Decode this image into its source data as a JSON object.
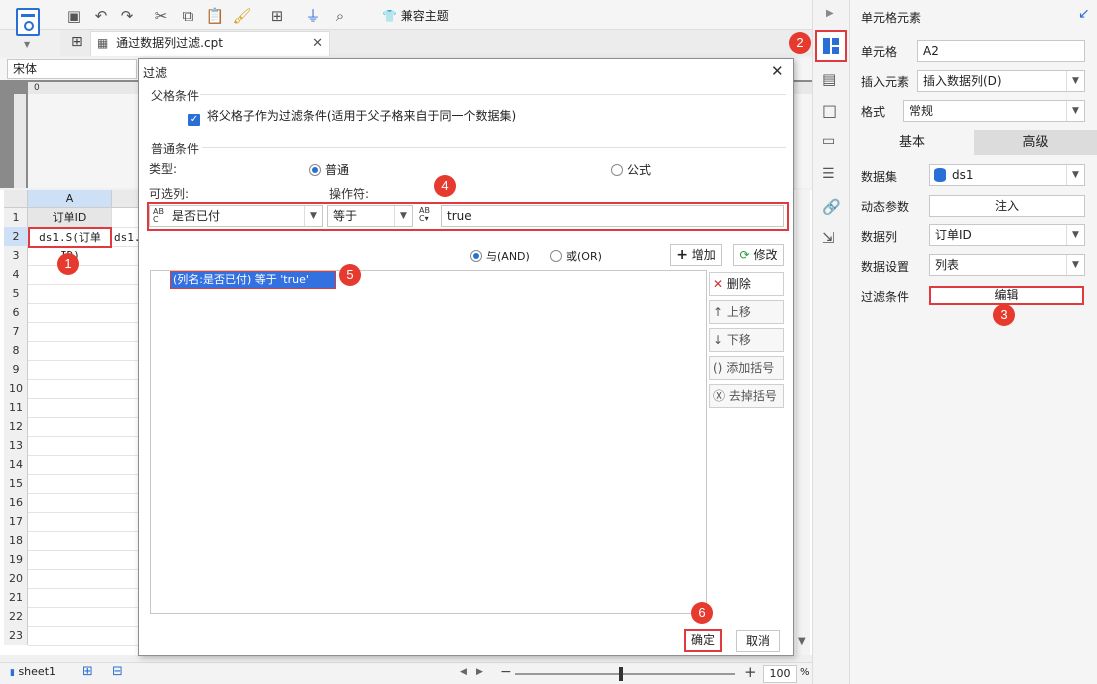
{
  "toolbar": {
    "theme_label": "兼容主题"
  },
  "tab": {
    "file_name": "通过数据列过滤.cpt"
  },
  "format_bar": {
    "font_name": "宋体"
  },
  "ruler": {
    "zero": "0"
  },
  "sheet": {
    "col_header": "A",
    "cell_a1": "订单ID",
    "cell_a2": "ds1.S(订单ID)",
    "cell_b2": "ds1.",
    "rows": [
      "1",
      "2",
      "3",
      "4",
      "5",
      "6",
      "7",
      "8",
      "9",
      "10",
      "11",
      "12",
      "13",
      "14",
      "15",
      "16",
      "17",
      "18",
      "19",
      "20",
      "21",
      "22",
      "23"
    ]
  },
  "bottom_bar": {
    "sheet_tab": "sheet1",
    "zoom_value": "100",
    "zoom_unit": "%",
    "minus": "−",
    "plus": "+"
  },
  "badges": [
    "1",
    "2",
    "3",
    "4",
    "5",
    "6"
  ],
  "dialog": {
    "title": "过滤",
    "parent_section": "父格条件",
    "parent_checkbox_label": "将父格子作为过滤条件(适用于父子格来自于同一个数据集)",
    "common_section": "普通条件",
    "type_label": "类型:",
    "type_normal": "普通",
    "type_formula": "公式",
    "column_label": "可选列:",
    "operator_label": "操作符:",
    "column_value": "是否已付",
    "operator_value": "等于",
    "value_text": "true",
    "and_label": "与(AND)",
    "or_label": "或(OR)",
    "add_button": "增加",
    "modify_button": "修改",
    "condition_item": "(列名:是否已付) 等于 'true'",
    "delete_button": "删除",
    "up_button": "上移",
    "down_button": "下移",
    "add_bracket_button": "添加括号",
    "remove_bracket_button": "去掉括号",
    "ok_button": "确定",
    "cancel_button": "取消"
  },
  "right_panel": {
    "title": "单元格元素",
    "cell_label": "单元格",
    "cell_value": "A2",
    "insert_label": "插入元素",
    "insert_value": "插入数据列(D)",
    "format_label": "格式",
    "format_value": "常规",
    "tab_basic": "基本",
    "tab_advanced": "高级",
    "dataset_label": "数据集",
    "dataset_value": "ds1",
    "param_label": "动态参数",
    "param_button": "注入",
    "column_label": "数据列",
    "column_value": "订单ID",
    "setting_label": "数据设置",
    "setting_value": "列表",
    "filter_label": "过滤条件",
    "filter_button": "编辑"
  },
  "colors": {
    "accent": "#2a6fd6",
    "badge_red": "#e63a2e",
    "highlight_border": "#e0393e",
    "selection_bg": "#3370e0"
  }
}
